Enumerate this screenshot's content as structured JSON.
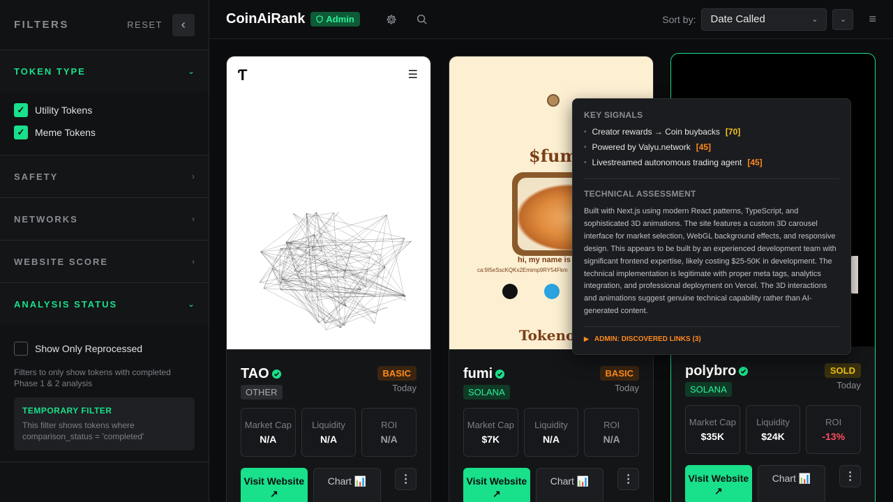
{
  "sidebar": {
    "title": "FILTERS",
    "reset": "RESET",
    "collapse_icon": "chevron-left-icon",
    "sections": {
      "token_type": {
        "label": "TOKEN TYPE",
        "options": [
          {
            "label": "Utility Tokens",
            "checked": true
          },
          {
            "label": "Meme Tokens",
            "checked": true
          }
        ]
      },
      "safety": {
        "label": "SAFETY"
      },
      "networks": {
        "label": "NETWORKS"
      },
      "website_score": {
        "label": "WEBSITE SCORE"
      },
      "analysis_status": {
        "label": "ANALYSIS STATUS",
        "option": {
          "label": "Show Only Reprocessed",
          "checked": false
        },
        "help": "Filters to only show tokens with completed Phase 1 & 2 analysis",
        "temp_title": "TEMPORARY FILTER",
        "temp_text": "This filter shows tokens where comparison_status = 'completed'"
      }
    }
  },
  "header": {
    "brand": "CoinAiRank",
    "badge": "Admin",
    "sort_label": "Sort by:",
    "sort_value": "Date Called"
  },
  "cards": [
    {
      "name": "TAO",
      "tier": "BASIC",
      "network": "OTHER",
      "date": "Today",
      "stats": {
        "mcap_label": "Market Cap",
        "mcap": "N/A",
        "liq_label": "Liquidity",
        "liq": "N/A",
        "roi_label": "ROI",
        "roi": "N/A"
      },
      "visit": "Visit Website ↗",
      "chart": "Chart 📊",
      "preview": {
        "logo": "Ƭ",
        "menu": "☰"
      }
    },
    {
      "name": "fumi",
      "tier": "BASIC",
      "network": "SOLANA",
      "date": "Today",
      "stats": {
        "mcap_label": "Market Cap",
        "mcap": "$7K",
        "liq_label": "Liquidity",
        "liq": "N/A",
        "roi_label": "ROI",
        "roi": "N/A"
      },
      "visit": "Visit Website ↗",
      "chart": "Chart 📊",
      "preview": {
        "title": "$fumi",
        "greeting": "hi, my name is f",
        "ca": "ca:9I5eSscKQKx2Emimp9RY54Fkm",
        "token_heading": "Tokeno"
      }
    },
    {
      "name": "polybro",
      "tier": "SOLD",
      "network": "SOLANA",
      "date": "Today",
      "stats": {
        "mcap_label": "Market Cap",
        "mcap": "$35K",
        "liq_label": "Liquidity",
        "liq": "$24K",
        "roi_label": "ROI",
        "roi": "-13%"
      },
      "visit": "Visit Website ↗",
      "chart": "Chart 📊"
    }
  ],
  "tooltip": {
    "signals_title": "KEY SIGNALS",
    "signals": [
      {
        "text": "Creator rewards → Coin buybacks",
        "score": "[70]",
        "color": "#f5c518"
      },
      {
        "text": "Powered by Valyu.network",
        "score": "[45]",
        "color": "#ff8a1f"
      },
      {
        "text": "Livestreamed autonomous trading agent",
        "score": "[45]",
        "color": "#ff8a1f"
      }
    ],
    "tech_title": "TECHNICAL ASSESSMENT",
    "tech_text": "Built with Next.js using modern React patterns, TypeScript, and sophisticated 3D animations. The site features a custom 3D carousel interface for market selection, WebGL background effects, and responsive design. This appears to be built by an experienced development team with significant frontend expertise, likely costing $25-50K in development. The technical implementation is legitimate with proper meta tags, analytics integration, and professional deployment on Vercel. The 3D interactions and animations suggest genuine technical capability rather than AI-generated content.",
    "links_label": "ADMIN: DISCOVERED LINKS (3)"
  },
  "colors": {
    "accent": "#19e08a",
    "basic": "#ff8a1f",
    "sold": "#f5c518",
    "negative": "#ff4d5e"
  }
}
